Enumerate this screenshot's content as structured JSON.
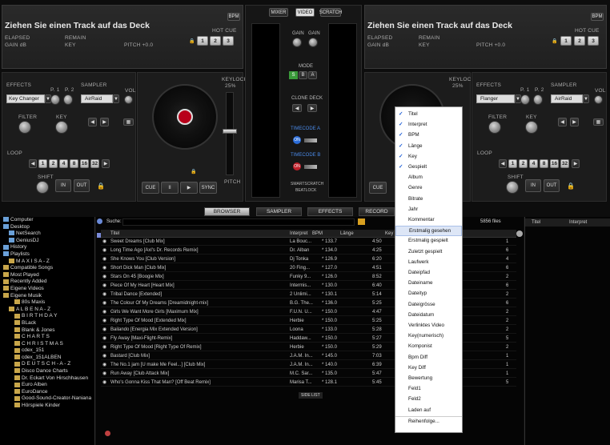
{
  "deck_left": {
    "title": "Ziehen Sie einen Track auf das Deck",
    "bpm_label": "BPM",
    "elapsed": "ELAPSED",
    "remain": "REMAIN",
    "gain": "GAIN dB",
    "key": "KEY",
    "pitch": "PITCH +0.0",
    "hot_cue": "HOT CUE",
    "hot_cues": [
      "1",
      "2",
      "3"
    ],
    "effects": "EFFECTS",
    "effect_value": "Key Changer",
    "p1": "P. 1",
    "p2": "P. 2",
    "sampler": "SAMPLER",
    "sampler_value": "AirRaid",
    "vol": "VOL",
    "filter": "FILTER",
    "key_knob": "KEY",
    "loop": "LOOP",
    "loop_values": [
      "1",
      "2",
      "4",
      "8",
      "16",
      "32"
    ],
    "shift": "SHIFT",
    "in": "IN",
    "out": "OUT",
    "keylock": "KEYLOCK",
    "keylock_pct": "25%",
    "pitch_lbl": "PITCH",
    "cue": "CUE",
    "play_pause": "II",
    "play": "▶",
    "sync": "SYNC"
  },
  "deck_right": {
    "title": "Ziehen Sie einen Track auf das Deck",
    "bpm_label": "BPM",
    "elapsed": "ELAPSED",
    "remain": "REMAIN",
    "gain": "GAIN dB",
    "key": "KEY",
    "pitch": "PITCH +0.0",
    "hot_cue": "HOT CUE",
    "hot_cues": [
      "1",
      "2",
      "3"
    ],
    "effects": "EFFECTS",
    "effect_value": "Flanger",
    "p1": "P. 1",
    "p2": "P. 2",
    "sampler": "SAMPLER",
    "sampler_value": "AirRaid",
    "vol": "VOL",
    "filter": "FILTER",
    "key_knob": "KEY",
    "loop": "LOOP",
    "loop_values": [
      "1",
      "2",
      "4",
      "8",
      "16",
      "32"
    ],
    "shift": "SHIFT",
    "in": "IN",
    "out": "OUT",
    "keylock": "KEYLOCK",
    "keylock_pct": "25%",
    "cue": "CUE"
  },
  "mixer": {
    "tabs": [
      "MIXER",
      "VIDEO",
      "SCRATCH"
    ],
    "gain": "GAIN",
    "mode": "MODE",
    "mode_btns": [
      "S",
      "B",
      "A"
    ],
    "clone_deck": "CLONE DECK",
    "timecode_a": "TIMECODE A",
    "timecode_b": "TIMECODE B",
    "on": "ON",
    "smartscratch": "SMARTSCRATCH",
    "beatlock": "BEATLOCK"
  },
  "tabs": [
    "BROWSER",
    "SAMPLER",
    "EFFECTS",
    "RECORD"
  ],
  "search": {
    "label": "Suche:",
    "files": "5856 files"
  },
  "tree": [
    {
      "t": "Computer",
      "c": "fold2",
      "i": 0
    },
    {
      "t": "Desktop",
      "c": "fold2",
      "i": 0
    },
    {
      "t": "NetSearch",
      "c": "fold2",
      "i": 1
    },
    {
      "t": "GeniusDJ",
      "c": "fold2",
      "i": 1
    },
    {
      "t": "History",
      "c": "fold2",
      "i": 0
    },
    {
      "t": "Playlists",
      "c": "fold2",
      "i": 0
    },
    {
      "t": "M A X I S  A - Z",
      "c": "fold",
      "i": 1
    },
    {
      "t": "Compatible Songs",
      "c": "fold",
      "i": 0
    },
    {
      "t": "Most Played",
      "c": "fold",
      "i": 0
    },
    {
      "t": "Recently Added",
      "c": "fold",
      "i": 0
    },
    {
      "t": "Eigene Videos",
      "c": "fold",
      "i": 0
    },
    {
      "t": "Eigene Musik",
      "c": "fold",
      "i": 0
    },
    {
      "t": "80s Maxis",
      "c": "fold",
      "i": 2
    },
    {
      "t": "A L B E N   A - Z",
      "c": "fold",
      "i": 1
    },
    {
      "t": "B I R T H D A Y",
      "c": "fold",
      "i": 2
    },
    {
      "t": "BLack",
      "c": "fold",
      "i": 2
    },
    {
      "t": "Blank & Jones",
      "c": "fold",
      "i": 2
    },
    {
      "t": "C H A R T S",
      "c": "fold",
      "i": 2
    },
    {
      "t": "C H R I S T M A S",
      "c": "fold",
      "i": 2
    },
    {
      "t": "cdex_151",
      "c": "fold",
      "i": 2
    },
    {
      "t": "cdex_151ALBEN",
      "c": "fold",
      "i": 2
    },
    {
      "t": "D E U T S C H - A - Z",
      "c": "fold",
      "i": 2
    },
    {
      "t": "Disco Dance Charts",
      "c": "fold",
      "i": 2
    },
    {
      "t": "Dr. Eckart Von Hirschhausen",
      "c": "fold",
      "i": 2
    },
    {
      "t": "Euro Alben",
      "c": "fold",
      "i": 2
    },
    {
      "t": "EuroDance",
      "c": "fold",
      "i": 2
    },
    {
      "t": "Good-Sound-Creator-Naniana",
      "c": "fold",
      "i": 2
    },
    {
      "t": "Hörspiele Kinder",
      "c": "fold",
      "i": 2
    }
  ],
  "columns": [
    "Titel",
    "Interpret",
    "BPM",
    "Länge",
    "Key"
  ],
  "tracks": [
    {
      "title": "Sweet Dreams [Club Mix]",
      "artist": "La Bouc...",
      "bpm": "* 133.7",
      "len": "4:50",
      "n": "1"
    },
    {
      "title": "Long Time Ago [Axl's Dr. Records Remix]",
      "artist": "Dr. Alban",
      "bpm": "* 134.0",
      "len": "4:25",
      "n": "6"
    },
    {
      "title": "She Knows You [Club Version]",
      "artist": "Dj Tonka",
      "bpm": "* 126.9",
      "len": "6:20",
      "n": "4"
    },
    {
      "title": "Short Dick Man [Club Mix]",
      "artist": "20 Fing...",
      "bpm": "* 127.0",
      "len": "4:51",
      "n": "6"
    },
    {
      "title": "Stars On 45 [Boogie Mix]",
      "artist": "Funky 9...",
      "bpm": "* 126.0",
      "len": "8:52",
      "n": "2"
    },
    {
      "title": "Piece Of My Heart [Heart Mix]",
      "artist": "Intermis...",
      "bpm": "* 130.0",
      "len": "6:40",
      "n": "6"
    },
    {
      "title": "Tribal Dance [Extended]",
      "artist": "2 Unlimi...",
      "bpm": "* 130.1",
      "len": "5:14",
      "n": "2"
    },
    {
      "title": "The Colour Of My Dreams [Dreamidnight-mix]",
      "artist": "B.G. The...",
      "bpm": "* 136.0",
      "len": "5:25",
      "n": "6"
    },
    {
      "title": "Girls We Want More Girls [Maximum Mix]",
      "artist": "F.U.N. U...",
      "bpm": "* 150.0",
      "len": "4:47",
      "n": "2"
    },
    {
      "title": "Right Type Of Mood [Extended Mix]",
      "artist": "Herbie",
      "bpm": "* 150.0",
      "len": "5:25",
      "n": "2"
    },
    {
      "title": "Bailando [Energia Mix Extended Version]",
      "artist": "Loona",
      "bpm": "* 133.0",
      "len": "5:28",
      "n": "2"
    },
    {
      "title": "Fly Away [Maxi-Flight-Remix]",
      "artist": "Haddaw...",
      "bpm": "* 150.0",
      "len": "5:27",
      "n": "5"
    },
    {
      "title": "Right Type Of Mood [Right Type Of Remix]",
      "artist": "Herbie",
      "bpm": "* 150.0",
      "len": "5:29",
      "n": "2"
    },
    {
      "title": "Bastard [Club Mix]",
      "artist": "J.A.M. In...",
      "bpm": "* 145.0",
      "len": "7:03",
      "n": "1"
    },
    {
      "title": "The No.1 jam [U make Me Feel...] [Club Mix]",
      "artist": "J.A.M. In...",
      "bpm": "* 140.0",
      "len": "6:39",
      "n": "1"
    },
    {
      "title": "Run Away [Club Attack Mix]",
      "artist": "M.C. Sar...",
      "bpm": "* 135.0",
      "len": "5:47",
      "n": "1"
    },
    {
      "title": "Who's Gonna Kiss That Man? [Off Beat Remix]",
      "artist": "Marisa T...",
      "bpm": "* 128.1",
      "len": "5:45",
      "n": "5"
    }
  ],
  "side_list": "SIDE LIST",
  "right_panel": {
    "col1": "Titel",
    "col2": "Interpret"
  },
  "menu": [
    {
      "t": "Titel",
      "c": true
    },
    {
      "t": "Interpret",
      "c": true
    },
    {
      "t": "BPM",
      "c": true
    },
    {
      "t": "Länge",
      "c": true
    },
    {
      "t": "Key",
      "c": true
    },
    {
      "t": "Gespielt",
      "c": true
    },
    {
      "t": "Album",
      "c": false
    },
    {
      "t": "Genre",
      "c": false
    },
    {
      "t": "Bitrate",
      "c": false
    },
    {
      "t": "Jahr",
      "c": false
    },
    {
      "t": "Kommentar",
      "c": false
    },
    {
      "t": "Erstmalig gesehen",
      "c": false,
      "hl": true
    },
    {
      "t": "Erstmalig gespielt",
      "c": false
    },
    {
      "t": "Zuletzt gespielt",
      "c": false
    },
    {
      "t": "Laufwerk",
      "c": false
    },
    {
      "t": "Dateipfad",
      "c": false
    },
    {
      "t": "Dateiname",
      "c": false
    },
    {
      "t": "Dateityp",
      "c": false
    },
    {
      "t": "Dateigrösse",
      "c": false
    },
    {
      "t": "Dateidatum",
      "c": false
    },
    {
      "t": "Verlinktes Video",
      "c": false
    },
    {
      "t": "Key(numerisch)",
      "c": false
    },
    {
      "t": "Komponist",
      "c": false
    },
    {
      "t": "Bpm Diff",
      "c": false
    },
    {
      "t": "Key Diff",
      "c": false
    },
    {
      "t": "Bewertung",
      "c": false
    },
    {
      "t": "Feld1",
      "c": false
    },
    {
      "t": "Feld2",
      "c": false
    },
    {
      "t": "Laden auf",
      "c": false
    },
    {
      "t": "Reihenfolge...",
      "c": false
    }
  ],
  "colors": {
    "accent_red": "#b8001a",
    "timecode_blue": "#2a6cd8",
    "check_blue": "#1a5bd6"
  }
}
